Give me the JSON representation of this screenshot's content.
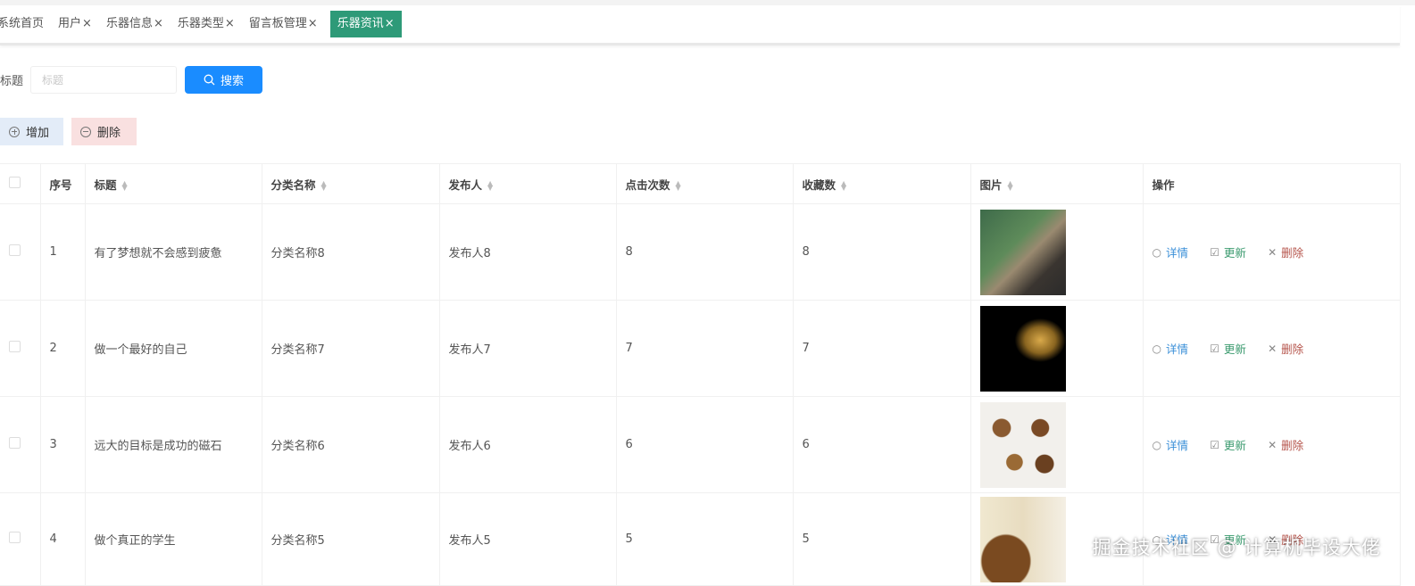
{
  "tabs": [
    {
      "label": "系统首页",
      "closable": false
    },
    {
      "label": "用户",
      "closable": true
    },
    {
      "label": "乐器信息",
      "closable": true
    },
    {
      "label": "乐器类型",
      "closable": true
    },
    {
      "label": "留言板管理",
      "closable": true
    },
    {
      "label": "乐器资讯",
      "closable": true,
      "active": true
    }
  ],
  "close_glyph": "×",
  "search": {
    "label": "标题",
    "placeholder": "标题",
    "button": "搜索"
  },
  "toolbar": {
    "add": "增加",
    "delete": "删除"
  },
  "table": {
    "headers": [
      "序号",
      "标题",
      "分类名称",
      "发布人",
      "点击次数",
      "收藏数",
      "图片",
      "操作"
    ],
    "rows": [
      {
        "index": "1",
        "title": "有了梦想就不会感到疲惫",
        "category": "分类名称8",
        "publisher": "发布人8",
        "clicks": "8",
        "favorites": "8",
        "image": "flute"
      },
      {
        "index": "2",
        "title": "做一个最好的自己",
        "category": "分类名称7",
        "publisher": "发布人7",
        "clicks": "7",
        "favorites": "7",
        "image": "trombone"
      },
      {
        "index": "3",
        "title": "远大的目标是成功的磁石",
        "category": "分类名称6",
        "publisher": "发布人6",
        "clicks": "6",
        "favorites": "6",
        "image": "drums"
      },
      {
        "index": "4",
        "title": "做个真正的学生",
        "category": "分类名称5",
        "publisher": "发布人5",
        "clicks": "5",
        "favorites": "5",
        "image": "sanxian"
      }
    ],
    "ops": {
      "detail": "详情",
      "update": "更新",
      "delete": "删除"
    }
  },
  "watermark": "掘金技术社区 @ 计算机毕设大佬",
  "colors": {
    "active_tab": "#2e9a78",
    "search_button": "#1a8cff"
  }
}
